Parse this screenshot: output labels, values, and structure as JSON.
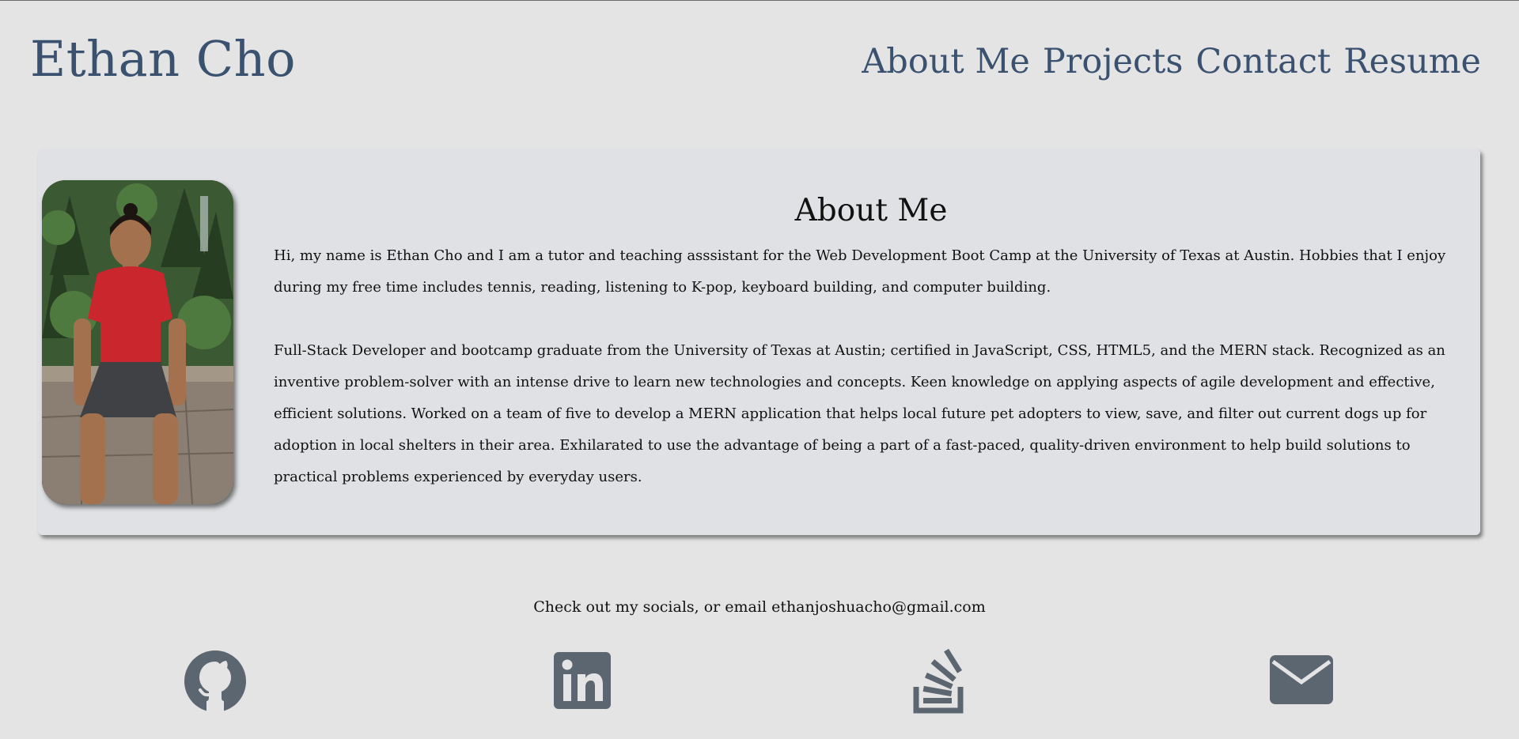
{
  "header": {
    "site_name": "Ethan Cho",
    "nav": [
      {
        "label": "About Me"
      },
      {
        "label": "Projects"
      },
      {
        "label": "Contact"
      },
      {
        "label": "Resume"
      }
    ]
  },
  "about": {
    "heading": "About Me",
    "paragraphs": [
      "Hi, my name is Ethan Cho and I am a tutor and teaching asssistant for the Web Development Boot Camp at the University of Texas at Austin. Hobbies that I enjoy during my free time includes tennis, reading, listening to K-pop, keyboard building, and computer building.",
      "Full-Stack Developer and bootcamp graduate from the University of Texas at Austin; certified in JavaScript, CSS, HTML5, and the MERN stack. Recognized as an inventive problem-solver with an intense drive to learn new technologies and concepts. Keen knowledge on applying aspects of agile development and effective, efficient solutions. Worked on a team of five to develop a MERN application that helps local future pet adopters to view, save, and filter out current dogs up for adoption in local shelters in their area. Exhilarated to use the advantage of being a part of a fast-paced, quality-driven environment to help build solutions to practical problems experienced by everyday users."
    ]
  },
  "socials": {
    "text": "Check out my socials, or email ethanjoshuacho@gmail.com",
    "icons": [
      {
        "name": "github-icon"
      },
      {
        "name": "linkedin-icon"
      },
      {
        "name": "stackoverflow-icon"
      },
      {
        "name": "envelope-icon"
      }
    ]
  },
  "colors": {
    "background": "#e4e4e4",
    "card": "#dfe1e4",
    "brand": "#3a5270",
    "icon": "#5c6670",
    "text": "#111111"
  }
}
